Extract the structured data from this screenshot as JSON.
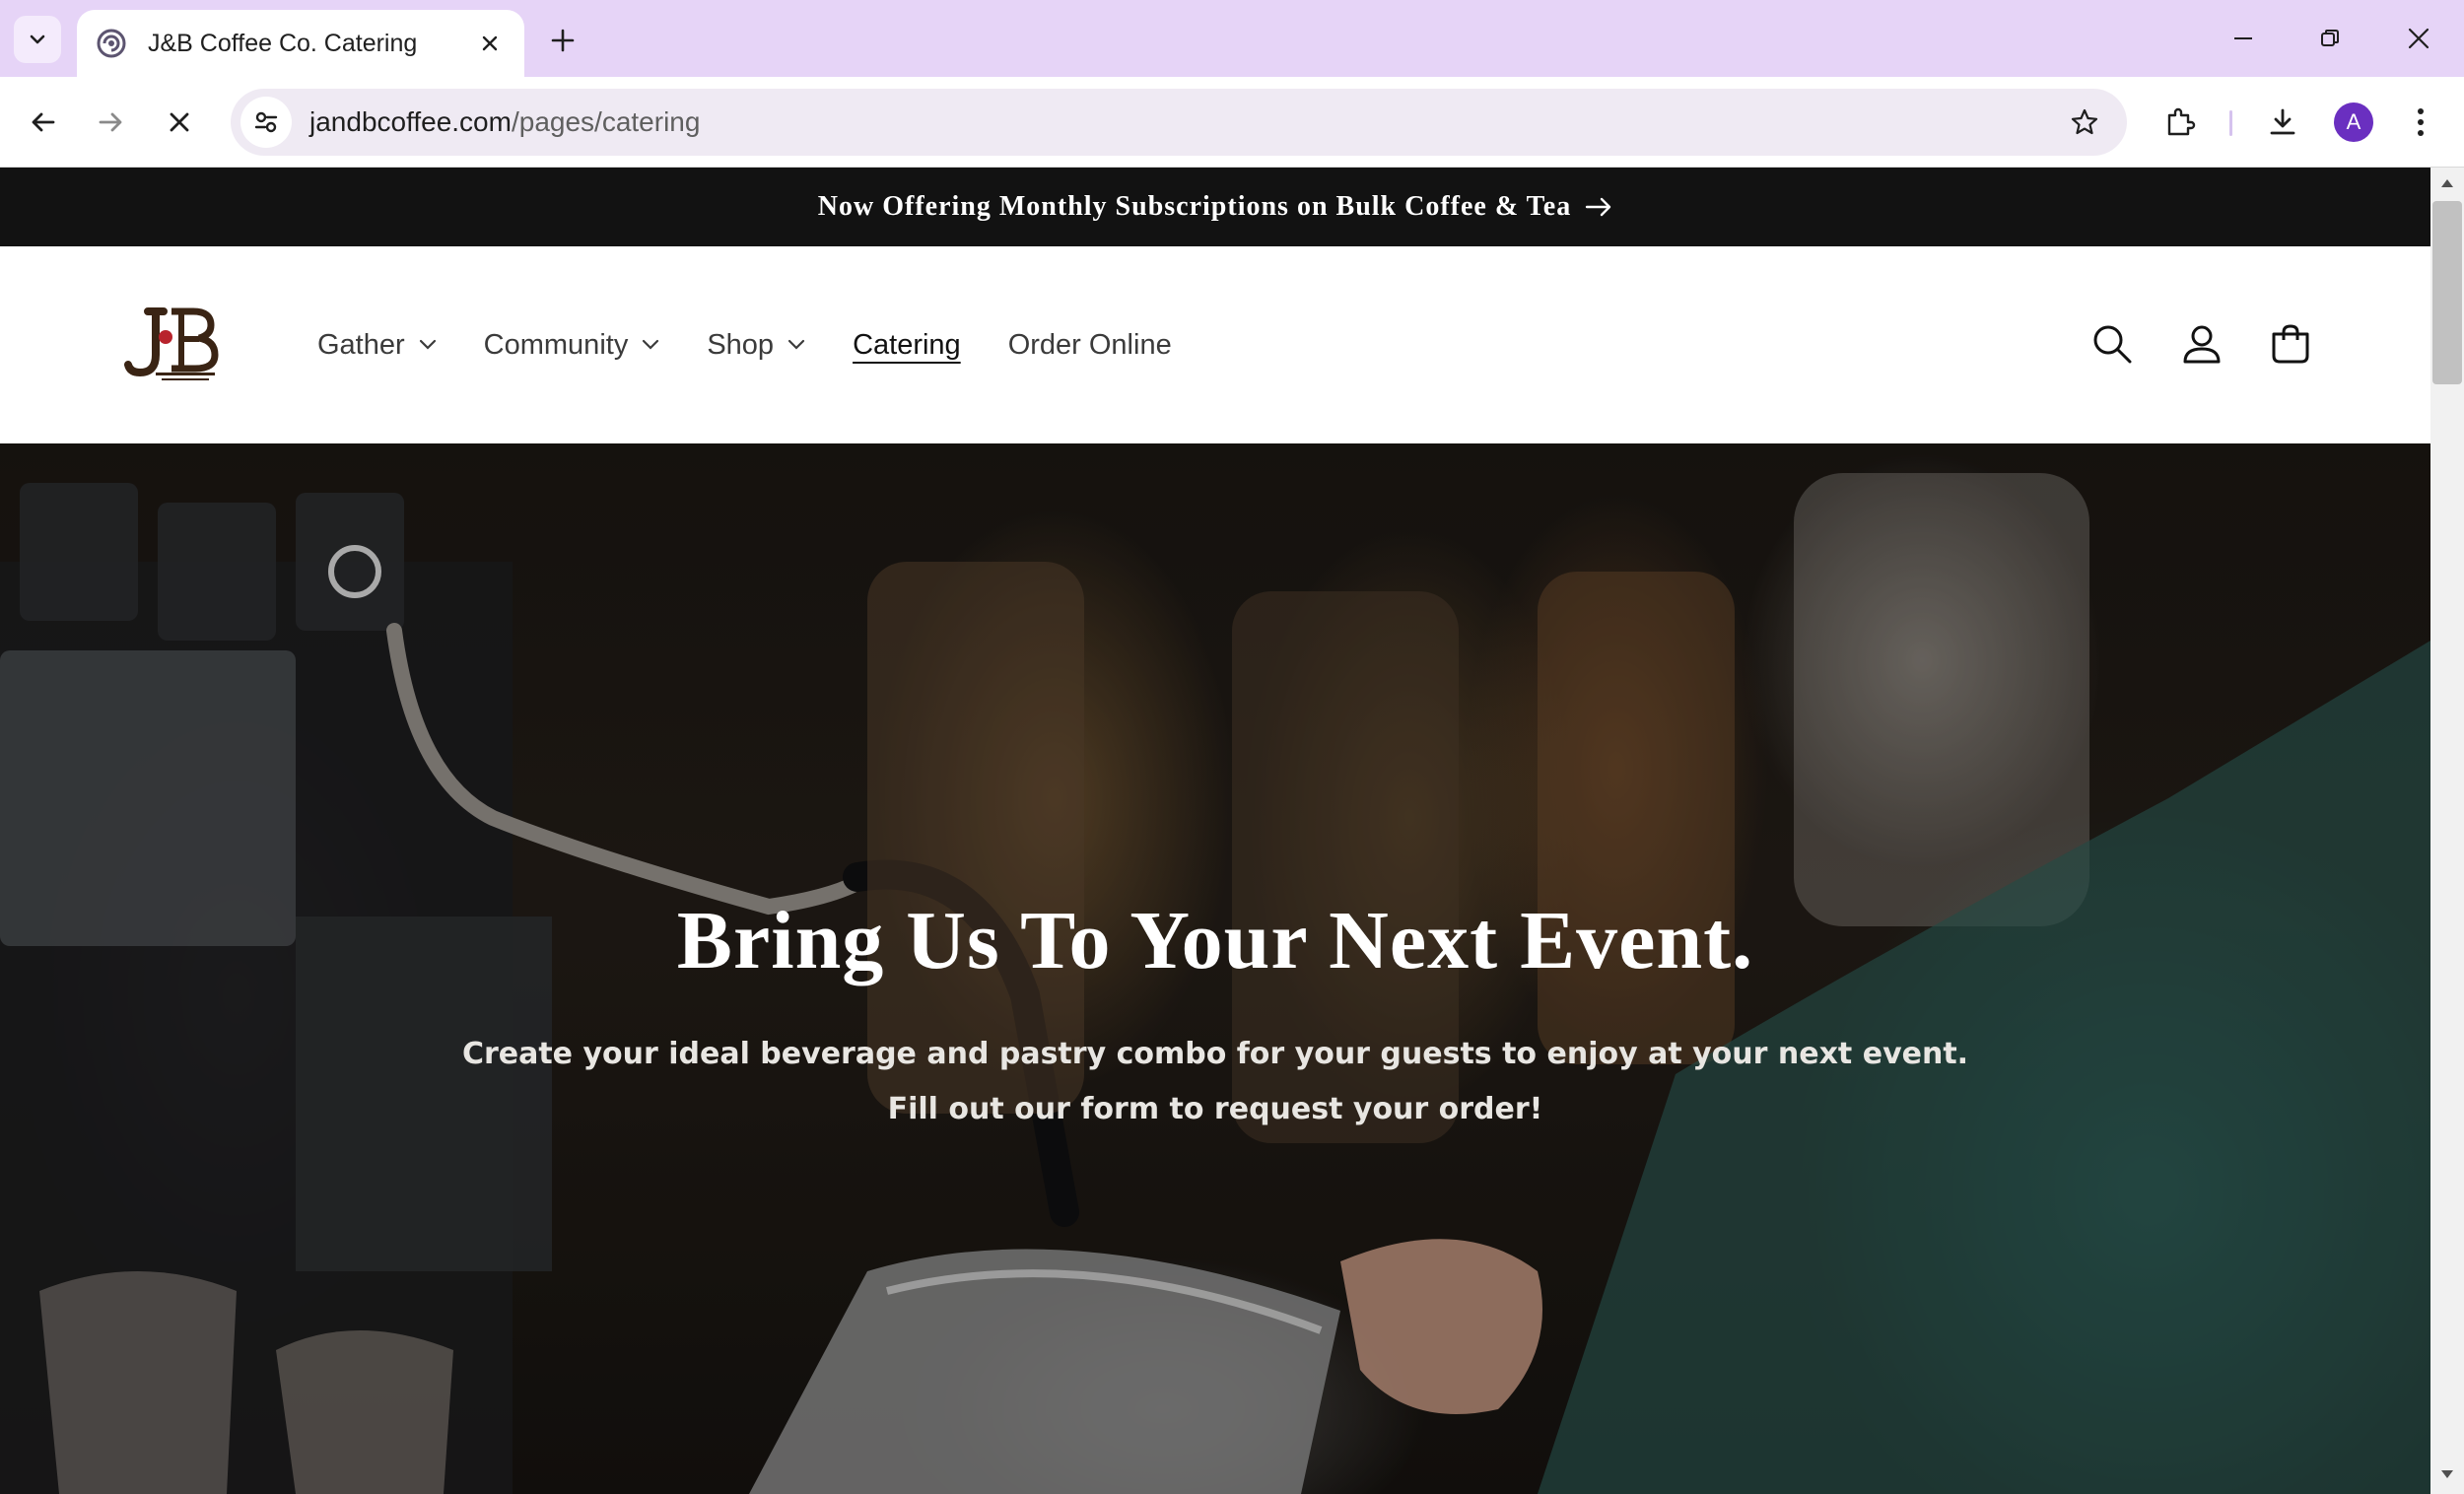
{
  "browser": {
    "tab": {
      "title": "J&B Coffee Co. Catering"
    },
    "url": {
      "host": "jandbcoffee.com",
      "path": "/pages/catering"
    },
    "profile_initial": "A"
  },
  "announcement": {
    "text": "Now Offering Monthly Subscriptions on Bulk Coffee & Tea"
  },
  "header": {
    "logo_icon": "jb-coffee-logo",
    "nav": [
      {
        "label": "Gather",
        "has_dropdown": true
      },
      {
        "label": "Community",
        "has_dropdown": true
      },
      {
        "label": "Shop",
        "has_dropdown": true
      },
      {
        "label": "Catering",
        "active": true
      },
      {
        "label": "Order Online"
      }
    ],
    "icons": [
      "search-icon",
      "account-icon",
      "cart-icon"
    ]
  },
  "hero": {
    "title": "Bring Us To Your Next Event.",
    "subtitle_line1": "Create your ideal beverage and pastry combo for your guests to enjoy at your next event.",
    "subtitle_line2": "Fill out our form to request your order!"
  },
  "colors": {
    "tabstrip": "#e6d4f7",
    "announcement_bg": "#121212",
    "logo_brown": "#3a2414",
    "logo_red": "#b8232c"
  }
}
